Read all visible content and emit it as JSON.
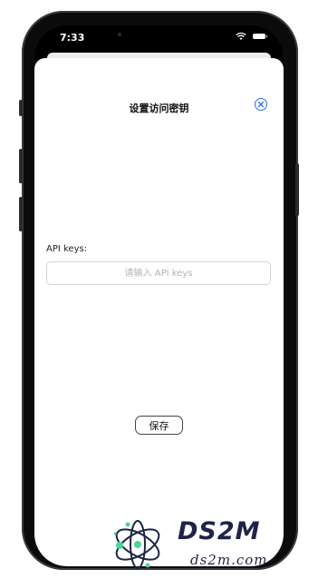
{
  "status_bar": {
    "time": "7:33"
  },
  "sheet": {
    "title": "设置访问密钥",
    "close_icon": "close-circle-icon"
  },
  "form": {
    "api_label": "API keys:",
    "api_input_value": "",
    "api_input_placeholder": "请输入 API keys",
    "save_label": "保存"
  },
  "watermark": {
    "main_text": "DS2M",
    "sub_text": "ds2m.com"
  },
  "colors": {
    "accent": "#2b6fe8",
    "phone_frame": "#0b0b0b",
    "watermark_text": "#1d2447",
    "watermark_dots": "#4ed39a"
  }
}
